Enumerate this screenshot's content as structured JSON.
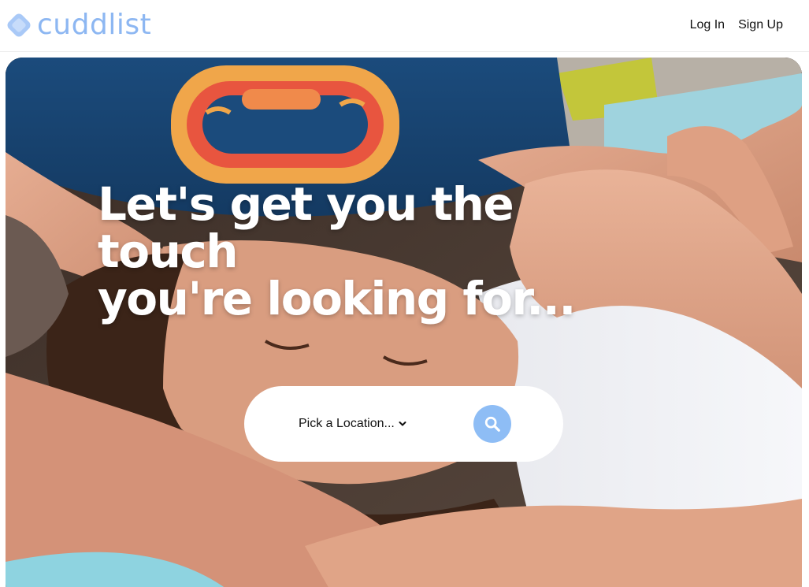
{
  "brand": {
    "name": "cuddlist",
    "color": "#8db7f2"
  },
  "nav": {
    "login_label": "Log In",
    "signup_label": "Sign Up"
  },
  "hero": {
    "headline_line1": "Let's get you the touch",
    "headline_line2": "you're looking for...",
    "image": "couple-cuddling-photo"
  },
  "search": {
    "location_label": "Pick a Location...",
    "location_icon": "chevron-down-icon",
    "button_icon": "search-icon",
    "button_color": "#8ebdf5"
  }
}
